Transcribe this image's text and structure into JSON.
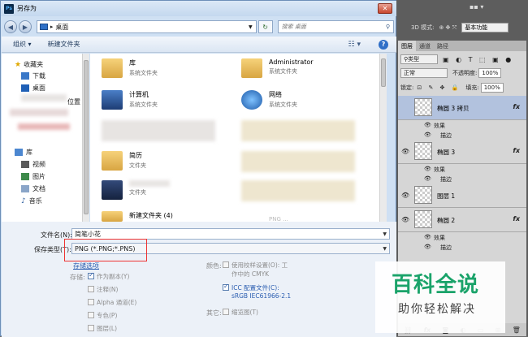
{
  "window": {
    "title": "另存为",
    "app_badge": "Ps",
    "close_label": "✕"
  },
  "address": {
    "path": "桌面",
    "search_placeholder": "搜索 桌面"
  },
  "toolbar": {
    "organize_label": "组织 ▾",
    "new_folder_label": "新建文件夹",
    "help_label": "?"
  },
  "nav": {
    "favorites_label": "收藏夹",
    "downloads_label": "下载",
    "desktop_label": "桌面",
    "recent_suffix": "位置",
    "library_label": "库",
    "video_label": "视频",
    "pictures_label": "图片",
    "documents_label": "文档",
    "music_label": "音乐"
  },
  "files": {
    "lib_name": "库",
    "lib_type": "系统文件夹",
    "admin_name": "Administrator",
    "admin_type": "系统文件夹",
    "computer_name": "计算机",
    "computer_type": "系统文件夹",
    "network_name": "网络",
    "network_type": "系统文件夹",
    "resume_name": "简历",
    "resume_type": "文件夹",
    "folder5_type": "文件夹",
    "newfolder_name": "新建文件夹 (4)",
    "partial_name": "PNG ..."
  },
  "form": {
    "filename_label": "文件名(N):",
    "filename_value": "简笔小花",
    "filetype_label": "保存类型(T):",
    "filetype_value": "PNG (*.PNG;*.PNS)",
    "save_options_label": "存储选项",
    "save_label": "存储:",
    "as_copy": "作为副本(Y)",
    "notes": "注释(N)",
    "alpha": "Alpha 通道(E)",
    "spot": "专色(P)",
    "layers": "图层(L)",
    "color_label": "颜色:",
    "use_proof_line1": "使用校样设置(O): 工",
    "use_proof_line2": "作中的 CMYK",
    "icc_line1": "ICC 配置文件(C):",
    "icc_line2": "sRGB IEC61966-2.1",
    "other_label": "其它:",
    "thumbnail": "缩览图(T)"
  },
  "ps": {
    "mode_3d": "3D 模式:",
    "workspace": "基本功能",
    "tabs": [
      "图层",
      "通道",
      "路径"
    ],
    "kind": "类型",
    "blend": "正常",
    "opacity_label": "不透明度:",
    "opacity_value": "100%",
    "lock_label": "锁定:",
    "fill_label": "填充:",
    "fill_value": "100%",
    "layer1": "椭圆 3 拷贝",
    "layer2": "椭圆 3",
    "layer3": "图层 1",
    "layer4": "椭圆 2",
    "effects": "效果",
    "stroke": "描边",
    "fx": "fx"
  },
  "watermark": {
    "title": "百科全说",
    "subtitle": "助你轻松解决"
  }
}
